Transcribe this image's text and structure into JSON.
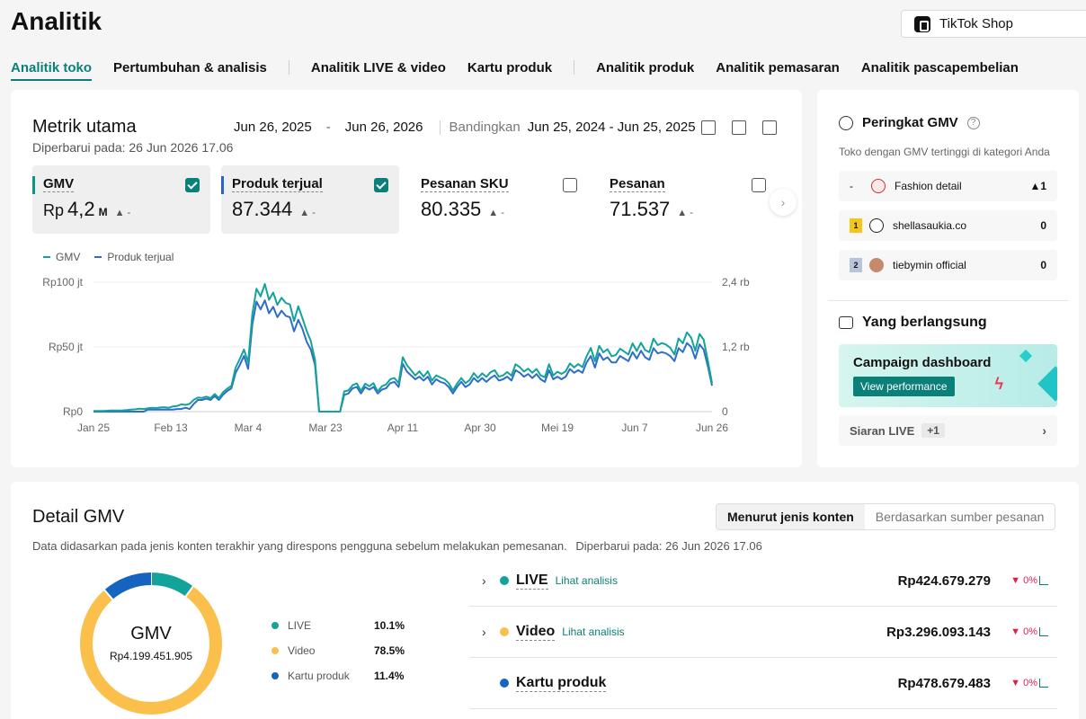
{
  "page": {
    "title": "Analitik"
  },
  "shop_selector": {
    "label": "TikTok Shop",
    "icon": "shopping-bag-icon"
  },
  "tabs": [
    {
      "label": "Analitik toko",
      "active": true
    },
    {
      "label": "Pertumbuhan & analisis"
    },
    {
      "label": "Analitik LIVE & video"
    },
    {
      "label": "Kartu produk"
    },
    {
      "label": "Analitik produk"
    },
    {
      "label": "Analitik pemasaran"
    },
    {
      "label": "Analitik pascapembelian"
    }
  ],
  "metrics": {
    "title": "Metrik utama",
    "updated": "Diperbarui pada: 26 Jun 2026 17.06",
    "date_start": "Jun 26, 2025",
    "date_sep": "-",
    "date_end": "Jun 26, 2026",
    "compare_label": "Bandingkan",
    "compare_range": "Jun 25, 2024 - Jun 25, 2025",
    "tiles": [
      {
        "label": "GMV",
        "currency": "Rp",
        "value": "4,2",
        "unit": "M",
        "trend": "▲ -",
        "selected": true,
        "checked": true,
        "accent": "#0d9488"
      },
      {
        "label": "Produk terjual",
        "value": "87.344",
        "trend": "▲ -",
        "selected": true,
        "checked": true,
        "accent": "#2b63c5"
      },
      {
        "label": "Pesanan SKU",
        "value": "80.335",
        "trend": "▲ -",
        "selected": false,
        "checked": false
      },
      {
        "label": "Pesanan",
        "value": "71.537",
        "trend": "▲ -",
        "selected": false,
        "checked": false
      }
    ],
    "legend": [
      {
        "name": "GMV",
        "color": "#14a39a"
      },
      {
        "name": "Produk terjual",
        "color": "#2f6ec8"
      }
    ]
  },
  "chart_data": {
    "type": "line",
    "x_ticks": [
      "Jan 25",
      "Feb 13",
      "Mar 4",
      "Mar 23",
      "Apr 11",
      "Apr 30",
      "Mei 19",
      "Jun 7",
      "Jun 26"
    ],
    "y_left_ticks": [
      "Rp0",
      "Rp50 jt",
      "Rp100 jt"
    ],
    "y_right_ticks": [
      "0",
      "1,2 rb",
      "2,4 rb"
    ],
    "ylim_left": [
      0,
      100
    ],
    "ylim_right": [
      0,
      2400
    ],
    "grid": true,
    "series": [
      {
        "name": "GMV",
        "unit": "Rp jt",
        "axis": "left",
        "color": "#14a39a",
        "values": [
          0.5,
          0.5,
          0.5,
          0.6,
          0.8,
          0.8,
          0.9,
          1,
          1.2,
          1.5,
          1.8,
          2.2,
          2,
          2.6,
          3,
          2.8,
          3.2,
          3.4,
          3,
          4,
          4.4,
          5.6,
          5.2,
          6,
          9.2,
          10.8,
          10.6,
          11.6,
          10.4,
          13.6,
          10.4,
          15,
          17.8,
          20,
          34,
          40.6,
          48,
          38,
          75,
          95,
          89,
          98.6,
          86.4,
          92,
          82.4,
          88,
          84,
          82.8,
          70,
          81.4,
          72.2,
          62.4,
          54.6,
          40,
          0,
          0,
          0,
          0,
          0,
          0,
          15.6,
          16.4,
          20.4,
          21.8,
          16,
          21.6,
          19.6,
          22,
          15.4,
          19.6,
          21,
          25,
          26,
          22,
          42,
          36,
          32,
          28,
          31.2,
          27,
          31.2,
          24,
          28,
          26.4,
          25,
          22,
          16.4,
          21.6,
          26,
          22,
          24.4,
          29.8,
          26,
          29.6,
          26.8,
          30.4,
          32,
          27,
          28,
          30.6,
          27.8,
          36.6,
          34.4,
          31,
          33.2,
          30,
          33,
          28,
          26.6,
          36.6,
          28,
          30.8,
          29.2,
          31.2,
          37.2,
          34.2,
          36.8,
          34.4,
          42.8,
          49.2,
          39,
          50.8,
          45.8,
          48.2,
          42.8,
          43.8,
          48.6,
          46.4,
          44.2,
          52.8,
          46.8,
          53.2,
          47.6,
          46,
          56.4,
          51.4,
          53,
          51.8,
          49.4,
          44.2,
          56.6,
          52.8,
          61.2,
          57.2,
          47,
          60,
          55.6,
          39.4,
          22
        ]
      },
      {
        "name": "Produk terjual",
        "unit": "unit",
        "axis": "right",
        "color": "#2f6ec8",
        "values": [
          0,
          0,
          0,
          0,
          0,
          0,
          0,
          0,
          0,
          0,
          0,
          0,
          0,
          36,
          36,
          36,
          36,
          36,
          36,
          36,
          48,
          48,
          72,
          48,
          144,
          216,
          216,
          240,
          216,
          288,
          216,
          312,
          384,
          432,
          720,
          864,
          1032,
          792,
          1608,
          2040,
          1896,
          2064,
          1824,
          1944,
          1752,
          1872,
          1776,
          1752,
          1488,
          1704,
          1536,
          1296,
          1152,
          864,
          0,
          0,
          0,
          0,
          0,
          0,
          312,
          336,
          432,
          456,
          336,
          456,
          408,
          456,
          336,
          408,
          432,
          528,
          552,
          456,
          888,
          744,
          672,
          600,
          648,
          576,
          648,
          504,
          600,
          552,
          528,
          456,
          336,
          456,
          552,
          456,
          504,
          624,
          552,
          624,
          552,
          624,
          672,
          576,
          600,
          648,
          576,
          768,
          720,
          648,
          696,
          624,
          696,
          600,
          552,
          768,
          600,
          648,
          600,
          648,
          792,
          720,
          768,
          720,
          912,
          1032,
          816,
          1080,
          960,
          1008,
          912,
          912,
          1032,
          984,
          936,
          1104,
          984,
          1128,
          1008,
          960,
          1176,
          1080,
          1104,
          1080,
          1032,
          936,
          1176,
          1104,
          1272,
          1200,
          984,
          1248,
          1152,
          840,
          480
        ]
      }
    ]
  },
  "ranking": {
    "title": "Peringkat GMV",
    "subtitle": "Toko dengan GMV tertinggi di kategori Anda",
    "rows": [
      {
        "position": "-",
        "name": "Fashion detail",
        "score": "▲1",
        "logo_color": "#c0392b"
      },
      {
        "position": "1",
        "name": "shellasaukia.co",
        "score": "0",
        "logo_color": "#222222",
        "medal_color": "#f5c518"
      },
      {
        "position": "2",
        "name": "tiebymin official",
        "score": "0",
        "logo_color": "#c58a6b",
        "medal_color": "#b8c4d9"
      }
    ]
  },
  "ongoing": {
    "title": "Yang berlangsung",
    "campaign_title": "Campaign dashboard",
    "campaign_button": "View performance",
    "live_label": "Siaran LIVE",
    "live_count": "+1"
  },
  "gmv_detail": {
    "title": "Detail GMV",
    "description": "Data didasarkan pada jenis konten terakhir yang direspons pengguna sebelum melakukan pemesanan.",
    "updated": "Diperbarui pada: 26 Jun 2026 17.06",
    "toggle": [
      "Menurut jenis konten",
      "Berdasarkan sumber pesanan"
    ],
    "donut_label": "GMV",
    "donut_total": "Rp4.199.451.905",
    "segments": [
      {
        "name": "LIVE",
        "pct": "10.1%",
        "value": 10.1,
        "color": "#14a39a"
      },
      {
        "name": "Video",
        "pct": "78.5%",
        "value": 78.5,
        "color": "#fbbf4b"
      },
      {
        "name": "Kartu produk",
        "pct": "11.4%",
        "value": 11.4,
        "color": "#1565c0"
      }
    ],
    "rows": [
      {
        "name": "LIVE",
        "link": "Lihat analisis",
        "amount": "Rp424.679.279",
        "change": "▼ 0%",
        "color": "#14a39a",
        "expandable": true
      },
      {
        "name": "Video",
        "link": "Lihat analisis",
        "amount": "Rp3.296.093.143",
        "change": "▼ 0%",
        "color": "#fbbf4b",
        "expandable": true
      },
      {
        "name": "Kartu produk",
        "link": "",
        "amount": "Rp478.679.483",
        "change": "▼ 0%",
        "color": "#1565c0",
        "expandable": false
      }
    ]
  }
}
